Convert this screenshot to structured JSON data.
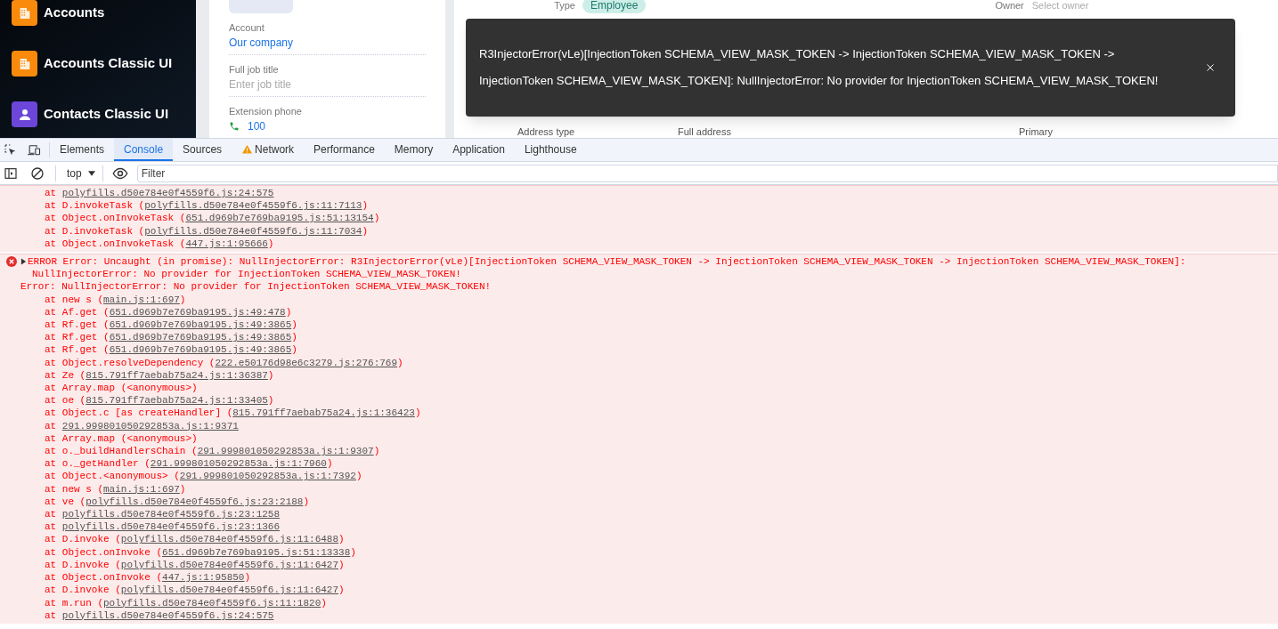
{
  "sidebar": {
    "items": [
      {
        "label": "Accounts",
        "kind": "building",
        "color": "#f98a0c"
      },
      {
        "label": "Accounts Classic UI",
        "kind": "building",
        "color": "#f98a0c"
      },
      {
        "label": "Contacts Classic UI",
        "kind": "person",
        "color": "#6b46d8"
      }
    ]
  },
  "contact_card": {
    "fields": [
      {
        "label": "Account",
        "value": "Our company",
        "kind": "link"
      },
      {
        "label": "Full job title",
        "placeholder": "Enter job title",
        "kind": "input"
      },
      {
        "label": "Extension phone",
        "value": "100",
        "kind": "phone"
      }
    ]
  },
  "details": {
    "type_label": "Type",
    "type_value": "Employee",
    "owner_label": "Owner",
    "owner_placeholder": "Select owner",
    "address_columns": [
      "Address type",
      "Full address",
      "Primary"
    ]
  },
  "toast": {
    "message": "R3InjectorError(vLe)[InjectionToken SCHEMA_VIEW_MASK_TOKEN -> InjectionToken SCHEMA_VIEW_MASK_TOKEN -> InjectionToken SCHEMA_VIEW_MASK_TOKEN]: NullInjectorError: No provider for InjectionToken SCHEMA_VIEW_MASK_TOKEN!"
  },
  "devtools": {
    "tabs": [
      {
        "label": "Elements",
        "selected": false,
        "warning": false
      },
      {
        "label": "Console",
        "selected": true,
        "warning": false
      },
      {
        "label": "Sources",
        "selected": false,
        "warning": false
      },
      {
        "label": "Network",
        "selected": false,
        "warning": true
      },
      {
        "label": "Performance",
        "selected": false,
        "warning": false
      },
      {
        "label": "Memory",
        "selected": false,
        "warning": false
      },
      {
        "label": "Application",
        "selected": false,
        "warning": false
      },
      {
        "label": "Lighthouse",
        "selected": false,
        "warning": false
      }
    ],
    "context": "top",
    "filter_placeholder": "Filter",
    "messages": [
      {
        "frames": [
          {
            "before": "at ",
            "link": "polyfills.d50e784e0f4559f6.js:24:575"
          },
          {
            "before": "at D.invokeTask (",
            "link": "polyfills.d50e784e0f4559f6.js:11:7113",
            "after": ")"
          },
          {
            "before": "at Object.onInvokeTask (",
            "link": "651.d969b7e769ba9195.js:51:13154",
            "after": ")"
          },
          {
            "before": "at D.invokeTask (",
            "link": "polyfills.d50e784e0f4559f6.js:11:7034",
            "after": ")"
          },
          {
            "before": "at Object.onInvokeTask (",
            "link": "447.js:1:95666",
            "after": ")"
          }
        ]
      },
      {
        "lines": [
          "ERROR Error: Uncaught (in promise): NullInjectorError: R3InjectorError(vLe)[InjectionToken SCHEMA_VIEW_MASK_TOKEN -> InjectionToken SCHEMA_VIEW_MASK_TOKEN -> InjectionToken SCHEMA_VIEW_MASK_TOKEN]:",
          "NullInjectorError: No provider for InjectionToken SCHEMA_VIEW_MASK_TOKEN!",
          "Error: NullInjectorError: No provider for InjectionToken SCHEMA_VIEW_MASK_TOKEN!"
        ],
        "frames": [
          {
            "before": "at new s (",
            "link": "main.js:1:697",
            "after": ")"
          },
          {
            "before": "at Af.get (",
            "link": "651.d969b7e769ba9195.js:49:478",
            "after": ")"
          },
          {
            "before": "at Rf.get (",
            "link": "651.d969b7e769ba9195.js:49:3865",
            "after": ")"
          },
          {
            "before": "at Rf.get (",
            "link": "651.d969b7e769ba9195.js:49:3865",
            "after": ")"
          },
          {
            "before": "at Rf.get (",
            "link": "651.d969b7e769ba9195.js:49:3865",
            "after": ")"
          },
          {
            "before": "at Object.resolveDependency (",
            "link": "222.e50176d98e6c3279.js:276:769",
            "after": ")"
          },
          {
            "before": "at Ze (",
            "link": "815.791ff7aebab75a24.js:1:36387",
            "after": ")"
          },
          {
            "before": "at Array.map (<anonymous>)"
          },
          {
            "before": "at oe (",
            "link": "815.791ff7aebab75a24.js:1:33405",
            "after": ")"
          },
          {
            "before": "at Object.c [as createHandler] (",
            "link": "815.791ff7aebab75a24.js:1:36423",
            "after": ")"
          },
          {
            "before": "at ",
            "link": "291.999801050292853a.js:1:9371"
          },
          {
            "before": "at Array.map (<anonymous>)"
          },
          {
            "before": "at o._buildHandlersChain (",
            "link": "291.999801050292853a.js:1:9307",
            "after": ")"
          },
          {
            "before": "at o._getHandler (",
            "link": "291.999801050292853a.js:1:7960",
            "after": ")"
          },
          {
            "before": "at Object.<anonymous> (",
            "link": "291.999801050292853a.js:1:7392",
            "after": ")"
          },
          {
            "before": "at new s (",
            "link": "main.js:1:697",
            "after": ")"
          },
          {
            "before": "at ve (",
            "link": "polyfills.d50e784e0f4559f6.js:23:2188",
            "after": ")"
          },
          {
            "before": "at ",
            "link": "polyfills.d50e784e0f4559f6.js:23:1258"
          },
          {
            "before": "at ",
            "link": "polyfills.d50e784e0f4559f6.js:23:1366"
          },
          {
            "before": "at D.invoke (",
            "link": "polyfills.d50e784e0f4559f6.js:11:6488",
            "after": ")"
          },
          {
            "before": "at Object.onInvoke (",
            "link": "651.d969b7e769ba9195.js:51:13338",
            "after": ")"
          },
          {
            "before": "at D.invoke (",
            "link": "polyfills.d50e784e0f4559f6.js:11:6427",
            "after": ")"
          },
          {
            "before": "at Object.onInvoke (",
            "link": "447.js:1:95850",
            "after": ")"
          },
          {
            "before": "at D.invoke (",
            "link": "polyfills.d50e784e0f4559f6.js:11:6427",
            "after": ")"
          },
          {
            "before": "at m.run (",
            "link": "polyfills.d50e784e0f4559f6.js:11:1820",
            "after": ")"
          },
          {
            "before": "at ",
            "link": "polyfills.d50e784e0f4559f6.js:24:575"
          }
        ]
      }
    ]
  }
}
